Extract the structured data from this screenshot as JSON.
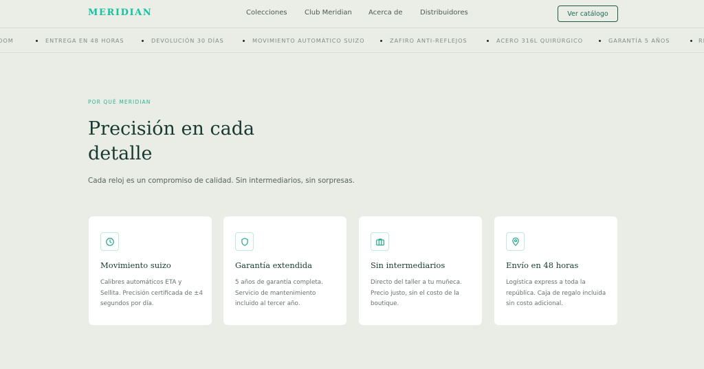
{
  "brand": "MERIDIAN",
  "nav": {
    "links": [
      "Colecciones",
      "Club Meridian",
      "Acerca de",
      "Distribuidores"
    ],
    "cta": "Ver catálogo"
  },
  "ticker": {
    "items": [
      "ENTREGA EN 48 HORAS",
      "DEVOLUCIÓN 30 DÍAS",
      "MOVIMIENTO AUTOMÁTICO SUIZO",
      "ZAFIRO ANTI-REFLEJOS",
      "ACERO 316L QUIRÚRGICO",
      "GARANTÍA 5 AÑOS"
    ],
    "leading_fragment": "OOM",
    "trailing_fragment": "RE"
  },
  "hero": {
    "eyebrow": "POR QUÉ MERIDIAN",
    "title": "Precisión en cada detalle",
    "subtitle": "Cada reloj es un compromiso de calidad. Sin intermediarios, sin sorpresas."
  },
  "features": [
    {
      "icon": "clock-icon",
      "title": "Movimiento suizo",
      "desc": "Calibres automáticos ETA y Sellita. Precisión certificada de ±4 segundos por día."
    },
    {
      "icon": "shield-icon",
      "title": "Garantía extendida",
      "desc": "5 años de garantía completa. Servicio de mantenimiento incluido al tercer año."
    },
    {
      "icon": "briefcase-icon",
      "title": "Sin intermediarios",
      "desc": "Directo del taller a tu muñeca. Precio justo, sin el costo de la boutique."
    },
    {
      "icon": "map-pin-icon",
      "title": "Envío en 48 horas",
      "desc": "Logística express a toda la república. Caja de regalo incluida sin costo adicional."
    }
  ],
  "colors": {
    "accent": "#12c2a0",
    "text_dark": "#163a31",
    "background": "#eaece6"
  }
}
